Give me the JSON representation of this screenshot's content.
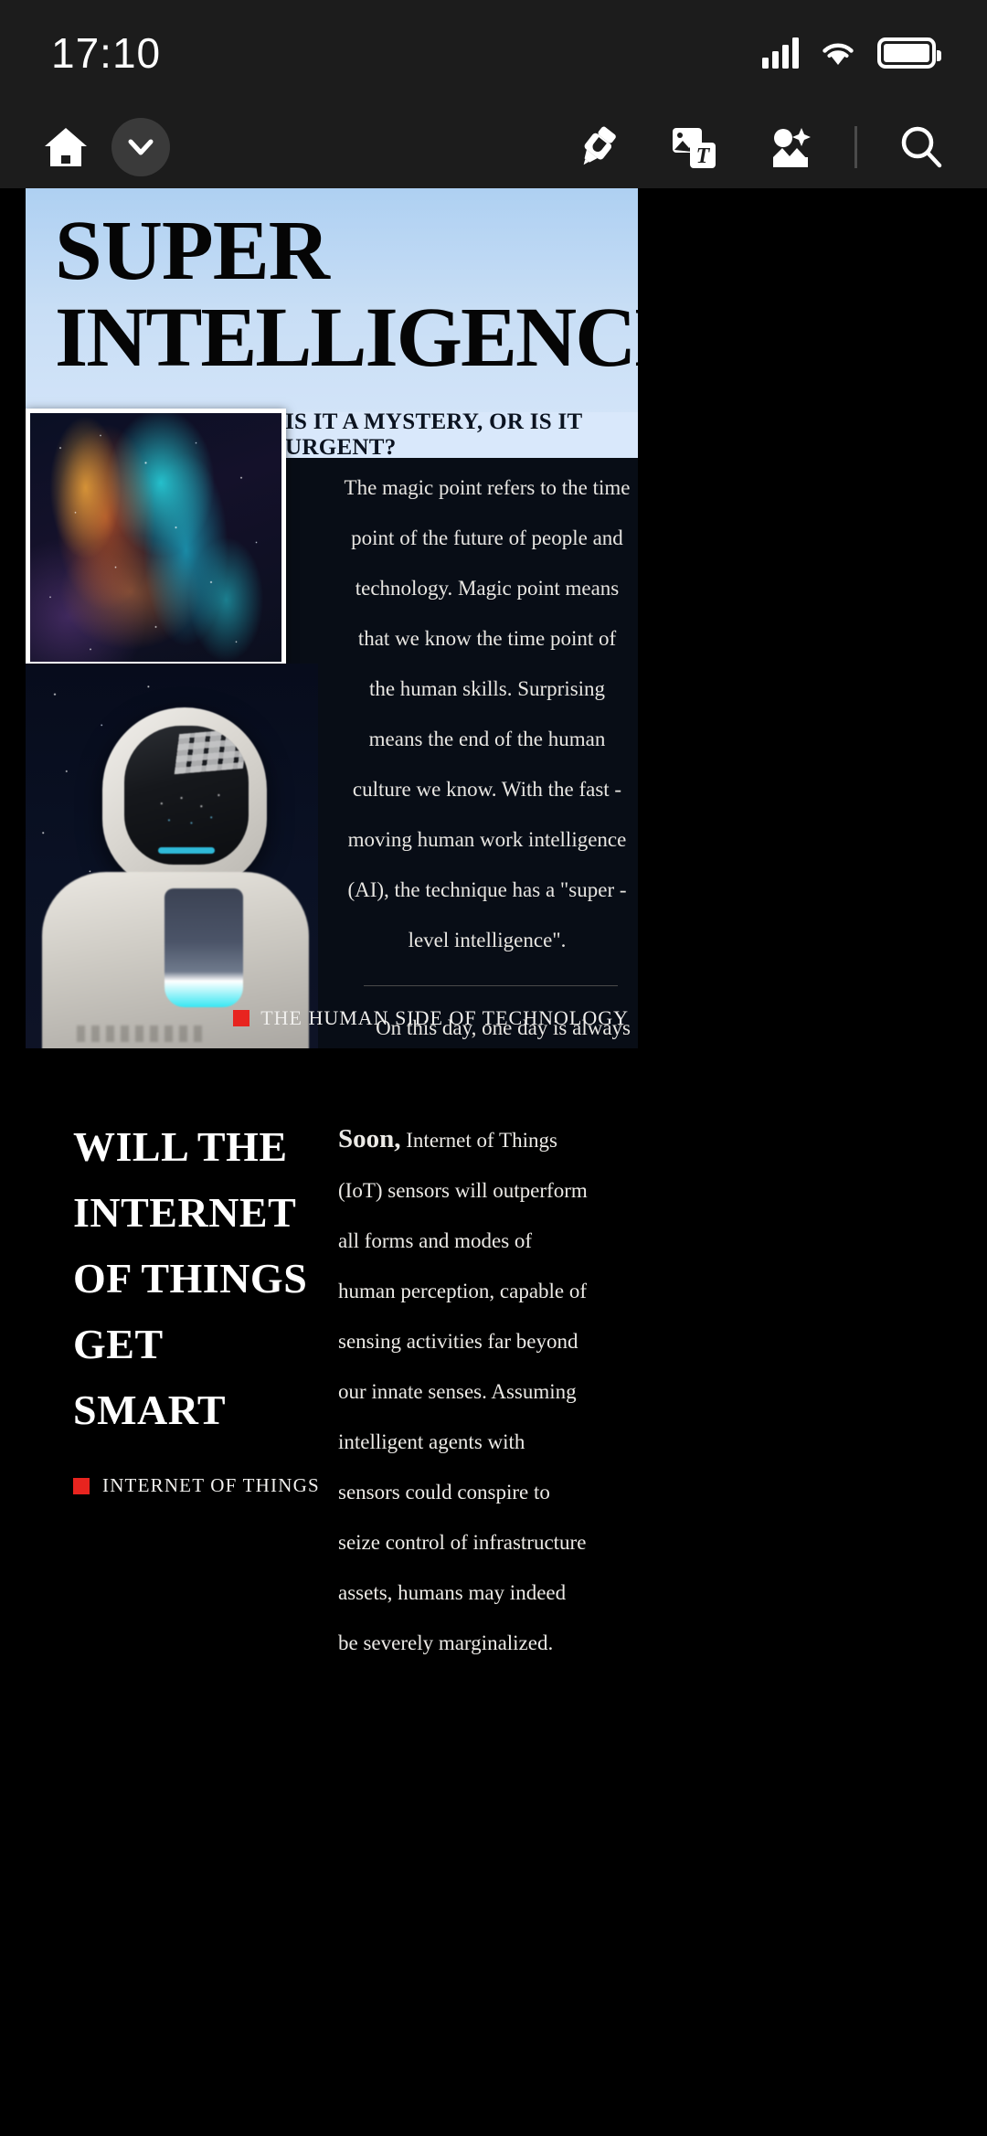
{
  "status_bar": {
    "time": "17:10",
    "signal_icon": "cellular-signal-icon",
    "wifi_icon": "wifi-icon",
    "battery_icon": "battery-full-icon"
  },
  "toolbar": {
    "home_icon": "home-icon",
    "chevron_icon": "chevron-down-icon",
    "highlighter_icon": "highlighter-pen-icon",
    "image_text_icon": "image-to-text-icon",
    "ai_image_icon": "ai-photo-magic-icon",
    "search_icon": "search-icon"
  },
  "article_1": {
    "title_line_1": "SUPER",
    "title_line_2": "INTELLIGENCE",
    "subtitle": "IS IT A MYSTERY, OR IS IT URGENT?",
    "photo_nebula": "nebula-photograph",
    "photo_robot": "robot-astronaut-photograph",
    "paragraph_1": "The magic point refers to the time point of the future of people and technology. Magic point means that we know the time point of the human skills. Surprising means the end of the human culture we know. With the fast -moving human work intelligence (AI), the technique has a \"super -level intelligence\".",
    "paragraph_2": "On this day, one day is always coming. Some people alert that super -speed intelligence will surpass human intelligence in the next 25 years. This makes people worry that they may become the pet of their robots unknowingly.",
    "tagline": "THE HUMAN SIDE OF TECHNOLOGY",
    "accent_color": "#e8241f"
  },
  "article_2": {
    "heading_line_1": "WILL THE",
    "heading_line_2": "INTERNET",
    "heading_line_3": "OF THINGS",
    "heading_line_4": "GET SMART",
    "tagline": "INTERNET OF THINGS",
    "body_lead": "Soon,",
    "body_text": " Internet of Things (IoT) sensors will outperform all forms and modes of human perception, capable of sensing activities far beyond our innate senses. Assuming intelligent agents with sensors could conspire to seize control of infrastructure assets, humans may indeed be severely marginalized.",
    "accent_color": "#e8241f"
  }
}
